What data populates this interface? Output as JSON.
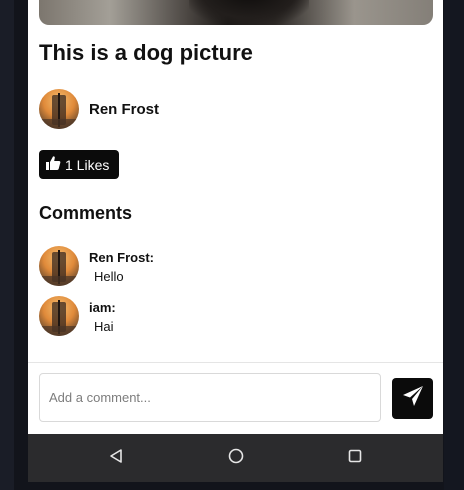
{
  "post": {
    "title": "This is a dog picture",
    "author": "Ren Frost",
    "likes_label": "1 Likes"
  },
  "comments": {
    "heading": "Comments",
    "items": [
      {
        "author": "Ren Frost:",
        "text": "Hello"
      },
      {
        "author": "iam:",
        "text": "Hai"
      }
    ]
  },
  "composer": {
    "placeholder": "Add a comment..."
  },
  "icons": {
    "like": "thumbs-up-icon",
    "send": "paper-plane-icon",
    "back": "back-triangle-icon",
    "home": "home-circle-icon",
    "recents": "recents-square-icon"
  },
  "colors": {
    "accent": "#0b0b0b",
    "navbar": "#2b2b2d",
    "background": "#ffffff"
  }
}
